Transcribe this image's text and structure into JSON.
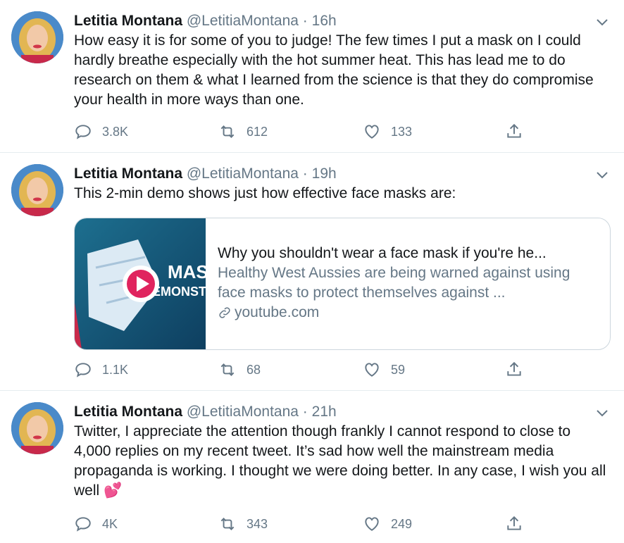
{
  "tweets": [
    {
      "name": "Letitia Montana",
      "handle": "@LetitiaMontana",
      "dot": "·",
      "time": "16h",
      "text": "How easy it is for some of you to judge! The few times I put a mask on I could hardly breathe especially with the hot summer heat. This has lead me to do research on them & what I learned from the science is that they do compromise your health in more ways than one.",
      "replies": "3.8K",
      "retweets": "612",
      "likes": "133"
    },
    {
      "name": "Letitia Montana",
      "handle": "@LetitiaMontana",
      "dot": "·",
      "time": "19h",
      "text": "This 2-min demo shows just how effective face masks are:",
      "card": {
        "title": "Why you shouldn't wear a face mask if you're he...",
        "description": "Healthy West Aussies are being warned against using face masks to protect themselves against ...",
        "domain": "youtube.com",
        "thumb_text_line1": "MAS",
        "thumb_text_line2": "EMONSTR"
      },
      "replies": "1.1K",
      "retweets": "68",
      "likes": "59"
    },
    {
      "name": "Letitia Montana",
      "handle": "@LetitiaMontana",
      "dot": "·",
      "time": "21h",
      "text": "Twitter, I appreciate the attention though frankly I cannot respond to close to 4,000 replies on my recent tweet. It’s sad how well the mainstream media propaganda is working. I thought we were doing better. In any case, I wish you all well",
      "emoji": "💕",
      "replies": "4K",
      "retweets": "343",
      "likes": "249"
    }
  ],
  "icons": {
    "reply": "reply-icon",
    "retweet": "retweet-icon",
    "like": "like-icon",
    "share": "share-icon",
    "caret": "chevron-down-icon",
    "link": "link-icon",
    "play": "play-icon"
  },
  "colors": {
    "text": "#14171a",
    "muted": "#657786",
    "border": "#e6ecf0",
    "play": "#e0245e"
  }
}
